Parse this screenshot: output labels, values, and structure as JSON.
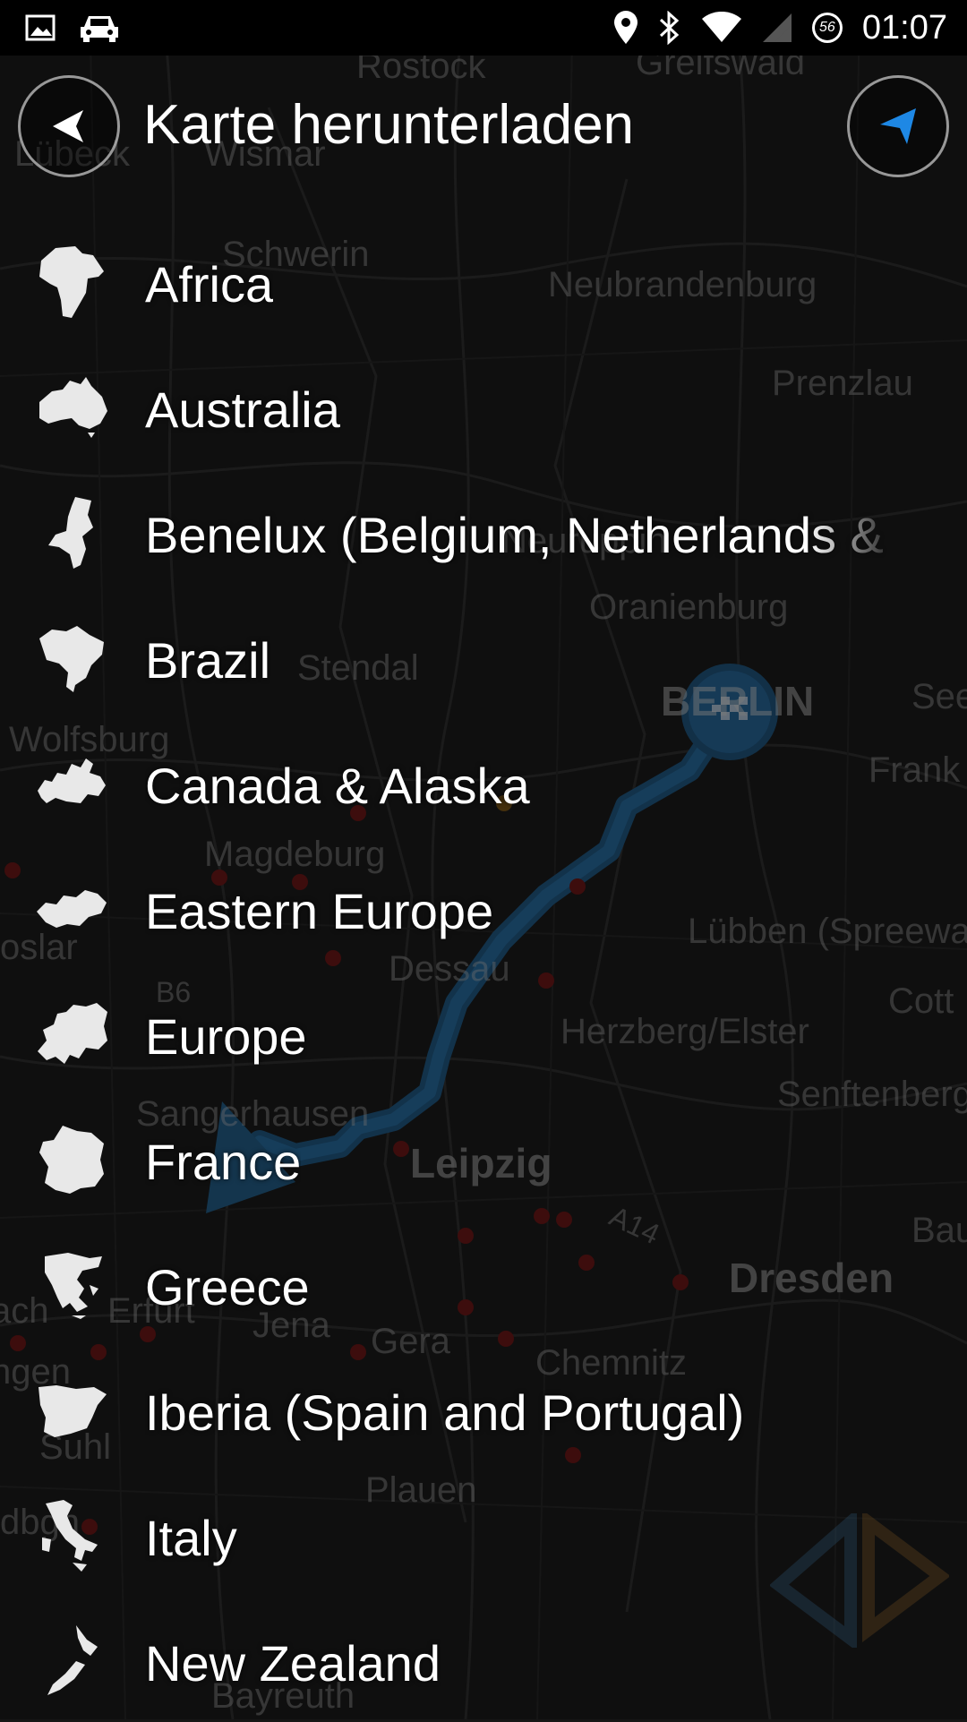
{
  "status_bar": {
    "time": "01:07",
    "battery_level": "56",
    "icons": [
      "image-icon",
      "car-icon",
      "location-pin-icon",
      "bluetooth-icon",
      "wifi-icon",
      "cellular-signal-icon",
      "battery-icon"
    ]
  },
  "header": {
    "title": "Karte herunterladen",
    "back_icon": "back-arrow-icon",
    "location_icon": "navigation-arrow-icon"
  },
  "regions": [
    {
      "label": "Africa",
      "icon": "africa-map-icon"
    },
    {
      "label": "Australia",
      "icon": "australia-map-icon"
    },
    {
      "label": "Benelux (Belgium, Netherlands & Luxe",
      "icon": "benelux-map-icon"
    },
    {
      "label": "Brazil",
      "icon": "brazil-map-icon"
    },
    {
      "label": "Canada & Alaska",
      "icon": "canada-map-icon"
    },
    {
      "label": "Eastern Europe",
      "icon": "eastern-europe-map-icon"
    },
    {
      "label": "Europe",
      "icon": "europe-map-icon"
    },
    {
      "label": "France",
      "icon": "france-map-icon"
    },
    {
      "label": "Greece",
      "icon": "greece-map-icon"
    },
    {
      "label": "Iberia (Spain and Portugal)",
      "icon": "iberia-map-icon"
    },
    {
      "label": "Italy",
      "icon": "italy-map-icon"
    },
    {
      "label": "New Zealand",
      "icon": "new-zealand-map-icon"
    }
  ],
  "map": {
    "labels": [
      "Rostock",
      "Greifswald",
      "Wismar",
      "Lübeck",
      "Schwerin",
      "Neubrandenburg",
      "Prenzlau",
      "Neuruppin",
      "Oranienburg",
      "Stendal",
      "Wolfsburg",
      "Frank",
      "See",
      "Magdeburg",
      "Lübben (Spreewa",
      "Dessau",
      "B6",
      "Cott",
      "Herzberg/Elster",
      "Senftenberg",
      "Sangerhausen",
      "Leipzig",
      "A14",
      "Bau",
      "Dresden",
      "Erfurt",
      "Jena",
      "Gera",
      "Chemnitz",
      "Suhl",
      "Plauen",
      "Bayreuth",
      "Goslar"
    ],
    "route_color": "#1e5f8f",
    "destination_icon": "checkered-flag-icon",
    "vehicle_icon": "vehicle-position-arrow-icon"
  },
  "colors": {
    "background": "#161616",
    "accent_blue": "#1e88e5",
    "route": "#1e5f8f",
    "poi_red": "#7a1818"
  }
}
